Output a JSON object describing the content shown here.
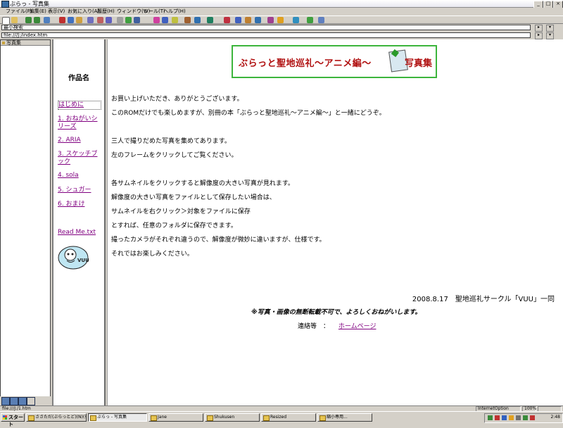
{
  "window": {
    "title": "ぶらっ - 写真集",
    "controls": [
      "_",
      "□",
      "×"
    ]
  },
  "menubar": [
    "ファイル(F)",
    "編集(E)",
    "表示(V)",
    "お気に入り(A)",
    "履歴(H)",
    "ウィンドウ(W)",
    "ツール(T)",
    "ヘルプ(H)"
  ],
  "address": {
    "search_value": "最小検索",
    "url": "file:///J:/index.htm"
  },
  "panel": {
    "header": "写真集"
  },
  "nav": {
    "title": "作品名",
    "links": [
      "はじめに",
      "1. おねがいシリーズ",
      "2. ARIA",
      "3. スケッチブック",
      "4. sola",
      "5. シュガー",
      "6. おまけ"
    ],
    "readme": "Read Me.txt"
  },
  "banner": {
    "text": "ぶらっと聖地巡礼～アニメ編～",
    "suffix": "写真集"
  },
  "content": {
    "paragraphs": [
      "お買い上げいただき、ありがとうございます。",
      "このROMだけでも楽しめますが、別冊の本「ぶらっと聖地巡礼～アニメ編～」と一緒にどうぞ。",
      "三人で撮りだめた写真を集めてあります。",
      "左のフレームをクリックしてご覧ください。",
      "各サムネイルをクリックすると解像度の大きい写真が見れます。",
      "解像度の大きい写真をファイルとして保存したい場合は、",
      "サムネイルを右クリック＞対象をファイルに保存",
      "とすれば、任意のフォルダに保存できます。",
      "撮ったカメラがそれぞれ違うので、解像度が微妙に違いますが、仕様です。",
      "それではお楽しみください。"
    ],
    "signature": "2008.8.17　聖地巡礼サークル「VUU」一同",
    "notice": "※写真・画像の無断転載不可で、よろしくおねがいします。",
    "contact_label": "連絡等　：",
    "contact_link": "ホームページ"
  },
  "statusbar": {
    "text": "file:///J:/1.htm",
    "zone": "InternetOption",
    "zoom": "100%"
  },
  "taskbar": {
    "start": "スタート",
    "tasks": [
      "ささただ(ぶらっとど)(N)(有...",
      "ぶらっ - 写真集",
      "Jane",
      "Shukusen",
      "Resized",
      "縮小専用..."
    ],
    "clock": "2:48"
  },
  "avatar_label": "VUU",
  "colors": {
    "link": "#800080",
    "banner_text": "#b01010",
    "banner_border": "#3cb53c"
  }
}
